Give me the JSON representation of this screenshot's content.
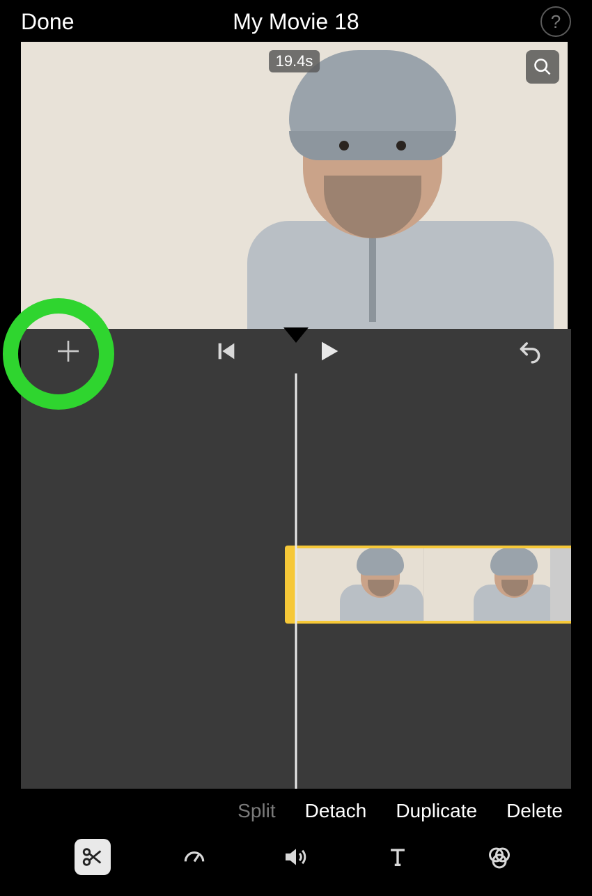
{
  "header": {
    "done_label": "Done",
    "title": "My Movie 18",
    "help_label": "?"
  },
  "preview": {
    "duration_text": "19.4s"
  },
  "actions": {
    "split": "Split",
    "detach": "Detach",
    "duplicate": "Duplicate",
    "delete": "Delete"
  },
  "icons": {
    "add": "plus-icon",
    "prev": "previous-icon",
    "play": "play-icon",
    "undo": "undo-icon",
    "zoom": "magnify-icon",
    "cut": "scissors-icon",
    "speed": "speedometer-icon",
    "volume": "speaker-icon",
    "text": "text-icon",
    "filter": "filters-icon"
  },
  "highlight": {
    "target": "add-media-button",
    "color": "#2fd52f"
  }
}
